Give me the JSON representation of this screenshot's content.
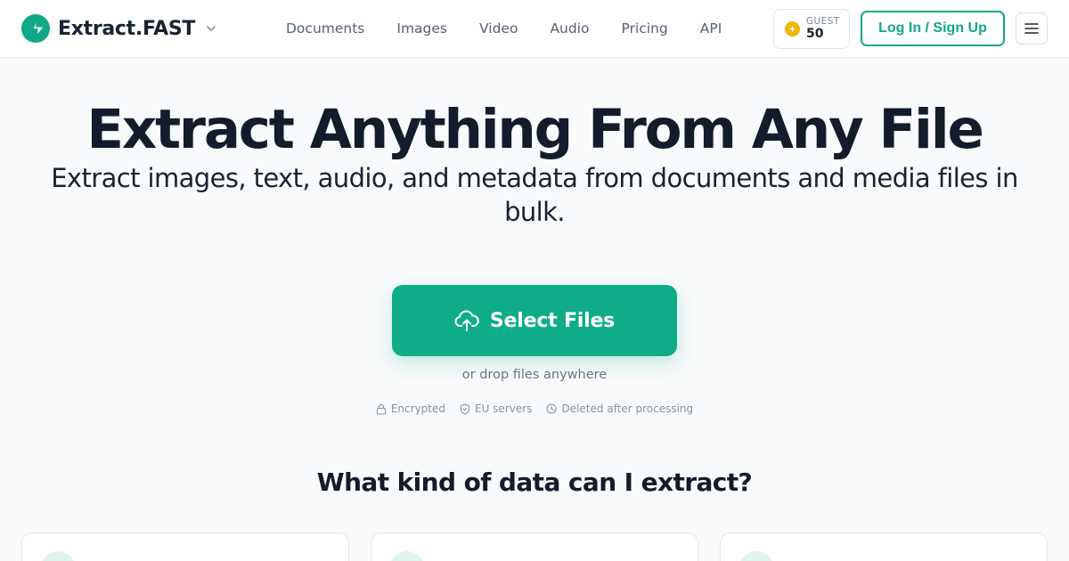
{
  "header": {
    "brand_name": "Extract.FAST",
    "nav": [
      "Documents",
      "Images",
      "Video",
      "Audio",
      "Pricing",
      "API"
    ],
    "credits": {
      "label": "GUEST",
      "value": "50"
    },
    "login_label": "Log In / Sign Up"
  },
  "hero": {
    "title": "Extract Anything From Any File",
    "subtitle": "Extract images, text, audio, and metadata from documents and media files in bulk.",
    "select_label": "Select Files",
    "drop_hint": "or drop files anywhere",
    "badges": [
      "Encrypted",
      "EU servers",
      "Deleted after processing"
    ]
  },
  "section": {
    "title": "What kind of data can I extract?"
  },
  "colors": {
    "accent": "#10a886",
    "coin": "#f2b705",
    "text": "#1a2332",
    "muted": "#6b7482"
  },
  "icons": {
    "brand": "bolt-icon",
    "chevron": "chevron-down-icon",
    "credits": "coin-icon",
    "menu": "hamburger-menu-icon",
    "upload": "cloud-upload-icon",
    "badges": [
      "lock-icon",
      "shield-icon",
      "clock-icon"
    ]
  }
}
